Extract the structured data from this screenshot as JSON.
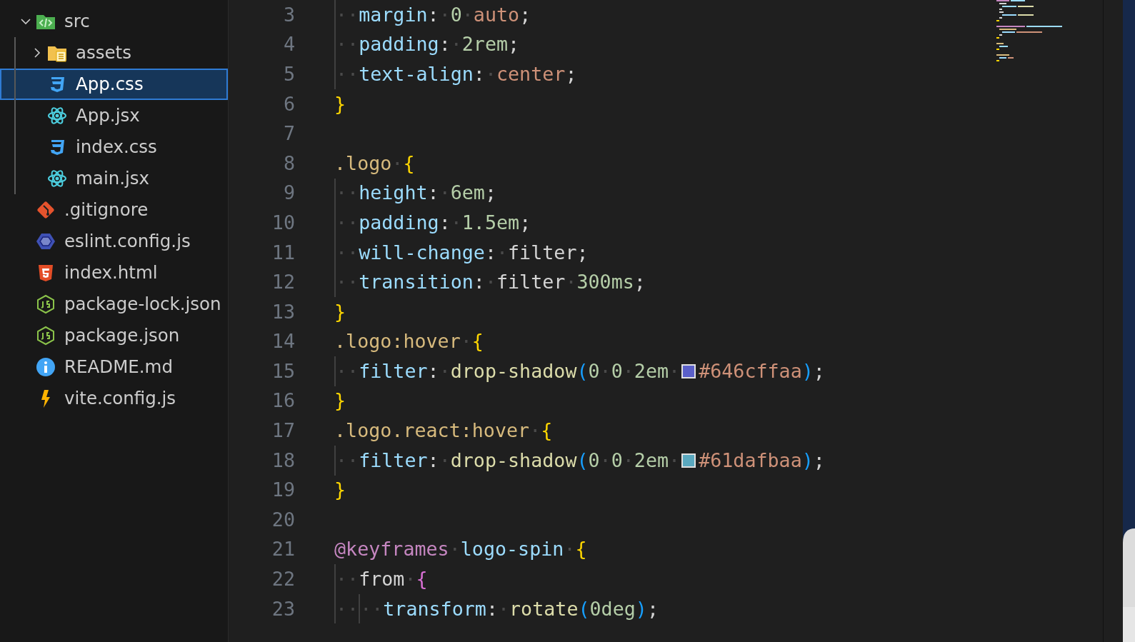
{
  "explorer": {
    "tree": [
      {
        "label": "src",
        "kind": "folder-code",
        "expanded": true,
        "selected": false,
        "children": [
          {
            "label": "assets",
            "kind": "folder-files",
            "expanded": false,
            "selected": false
          },
          {
            "label": "App.css",
            "kind": "css",
            "selected": true
          },
          {
            "label": "App.jsx",
            "kind": "react",
            "selected": false
          },
          {
            "label": "index.css",
            "kind": "css",
            "selected": false
          },
          {
            "label": "main.jsx",
            "kind": "react",
            "selected": false
          }
        ]
      },
      {
        "label": ".gitignore",
        "kind": "git",
        "selected": false
      },
      {
        "label": "eslint.config.js",
        "kind": "eslint",
        "selected": false
      },
      {
        "label": "index.html",
        "kind": "html",
        "selected": false
      },
      {
        "label": "package-lock.json",
        "kind": "node",
        "selected": false
      },
      {
        "label": "package.json",
        "kind": "node",
        "selected": false
      },
      {
        "label": "README.md",
        "kind": "info",
        "selected": false
      },
      {
        "label": "vite.config.js",
        "kind": "vite",
        "selected": false
      }
    ]
  },
  "editor": {
    "lines": [
      {
        "number": "3",
        "tokens": [
          {
            "kind": "guide",
            "t": "··"
          },
          {
            "kind": "prop",
            "t": "margin"
          },
          {
            "kind": "punct",
            "t": ":"
          },
          {
            "kind": "ws",
            "t": "·"
          },
          {
            "kind": "num",
            "t": "0"
          },
          {
            "kind": "ws",
            "t": "·"
          },
          {
            "kind": "str",
            "t": "auto"
          },
          {
            "kind": "punct",
            "t": ";"
          }
        ]
      },
      {
        "number": "4",
        "tokens": [
          {
            "kind": "guide",
            "t": "··"
          },
          {
            "kind": "prop",
            "t": "padding"
          },
          {
            "kind": "punct",
            "t": ":"
          },
          {
            "kind": "ws",
            "t": "·"
          },
          {
            "kind": "num",
            "t": "2rem"
          },
          {
            "kind": "punct",
            "t": ";"
          }
        ]
      },
      {
        "number": "5",
        "tokens": [
          {
            "kind": "guide",
            "t": "··"
          },
          {
            "kind": "prop",
            "t": "text-align"
          },
          {
            "kind": "punct",
            "t": ":"
          },
          {
            "kind": "ws",
            "t": "·"
          },
          {
            "kind": "str",
            "t": "center"
          },
          {
            "kind": "punct",
            "t": ";"
          }
        ]
      },
      {
        "number": "6",
        "tokens": [
          {
            "kind": "brace",
            "t": "}"
          }
        ]
      },
      {
        "number": "7"
      },
      {
        "number": "8",
        "tokens": [
          {
            "kind": "sel",
            "t": ".logo"
          },
          {
            "kind": "ws",
            "t": "·"
          },
          {
            "kind": "brace",
            "t": "{"
          }
        ]
      },
      {
        "number": "9",
        "tokens": [
          {
            "kind": "guide",
            "t": "··"
          },
          {
            "kind": "prop",
            "t": "height"
          },
          {
            "kind": "punct",
            "t": ":"
          },
          {
            "kind": "ws",
            "t": "·"
          },
          {
            "kind": "num",
            "t": "6em"
          },
          {
            "kind": "punct",
            "t": ";"
          }
        ]
      },
      {
        "number": "10",
        "tokens": [
          {
            "kind": "guide",
            "t": "··"
          },
          {
            "kind": "prop",
            "t": "padding"
          },
          {
            "kind": "punct",
            "t": ":"
          },
          {
            "kind": "ws",
            "t": "·"
          },
          {
            "kind": "num",
            "t": "1.5em"
          },
          {
            "kind": "punct",
            "t": ";"
          }
        ]
      },
      {
        "number": "11",
        "tokens": [
          {
            "kind": "guide",
            "t": "··"
          },
          {
            "kind": "prop",
            "t": "will-change"
          },
          {
            "kind": "punct",
            "t": ":"
          },
          {
            "kind": "ws",
            "t": "·"
          },
          {
            "kind": "plain",
            "t": "filter"
          },
          {
            "kind": "punct",
            "t": ";"
          }
        ]
      },
      {
        "number": "12",
        "tokens": [
          {
            "kind": "guide",
            "t": "··"
          },
          {
            "kind": "prop",
            "t": "transition"
          },
          {
            "kind": "punct",
            "t": ":"
          },
          {
            "kind": "ws",
            "t": "·"
          },
          {
            "kind": "plain",
            "t": "filter"
          },
          {
            "kind": "ws",
            "t": "·"
          },
          {
            "kind": "num",
            "t": "300ms"
          },
          {
            "kind": "punct",
            "t": ";"
          }
        ]
      },
      {
        "number": "13",
        "tokens": [
          {
            "kind": "brace",
            "t": "}"
          }
        ]
      },
      {
        "number": "14",
        "tokens": [
          {
            "kind": "sel",
            "t": ".logo:hover"
          },
          {
            "kind": "ws",
            "t": "·"
          },
          {
            "kind": "brace",
            "t": "{"
          }
        ]
      },
      {
        "number": "15",
        "tokens": [
          {
            "kind": "guide",
            "t": "··"
          },
          {
            "kind": "prop",
            "t": "filter"
          },
          {
            "kind": "punct",
            "t": ":"
          },
          {
            "kind": "ws",
            "t": "·"
          },
          {
            "kind": "func",
            "t": "drop-shadow"
          },
          {
            "kind": "paren",
            "t": "("
          },
          {
            "kind": "num",
            "t": "0"
          },
          {
            "kind": "ws",
            "t": "·"
          },
          {
            "kind": "num",
            "t": "0"
          },
          {
            "kind": "ws",
            "t": "·"
          },
          {
            "kind": "num",
            "t": "2em"
          },
          {
            "kind": "ws",
            "t": "·"
          },
          {
            "kind": "swatch",
            "color": "#5a5fc8"
          },
          {
            "kind": "str",
            "t": "#646cffaa"
          },
          {
            "kind": "paren",
            "t": ")"
          },
          {
            "kind": "punct",
            "t": ";"
          }
        ]
      },
      {
        "number": "16",
        "tokens": [
          {
            "kind": "brace",
            "t": "}"
          }
        ]
      },
      {
        "number": "17",
        "tokens": [
          {
            "kind": "sel",
            "t": ".logo.react:hover"
          },
          {
            "kind": "ws",
            "t": "·"
          },
          {
            "kind": "brace",
            "t": "{"
          }
        ]
      },
      {
        "number": "18",
        "tokens": [
          {
            "kind": "guide",
            "t": "··"
          },
          {
            "kind": "prop",
            "t": "filter"
          },
          {
            "kind": "punct",
            "t": ":"
          },
          {
            "kind": "ws",
            "t": "·"
          },
          {
            "kind": "func",
            "t": "drop-shadow"
          },
          {
            "kind": "paren",
            "t": "("
          },
          {
            "kind": "num",
            "t": "0"
          },
          {
            "kind": "ws",
            "t": "·"
          },
          {
            "kind": "num",
            "t": "0"
          },
          {
            "kind": "ws",
            "t": "·"
          },
          {
            "kind": "num",
            "t": "2em"
          },
          {
            "kind": "ws",
            "t": "·"
          },
          {
            "kind": "swatch",
            "color": "#5aa8bf"
          },
          {
            "kind": "str",
            "t": "#61dafbaa"
          },
          {
            "kind": "paren",
            "t": ")"
          },
          {
            "kind": "punct",
            "t": ";"
          }
        ]
      },
      {
        "number": "19",
        "tokens": [
          {
            "kind": "brace",
            "t": "}"
          }
        ]
      },
      {
        "number": "20"
      },
      {
        "number": "21",
        "tokens": [
          {
            "kind": "at",
            "t": "@keyframes"
          },
          {
            "kind": "ws",
            "t": "·"
          },
          {
            "kind": "prop",
            "t": "logo-spin"
          },
          {
            "kind": "ws",
            "t": "·"
          },
          {
            "kind": "brace",
            "t": "{"
          }
        ]
      },
      {
        "number": "22",
        "tokens": [
          {
            "kind": "guide",
            "t": "··"
          },
          {
            "kind": "plain",
            "t": "from"
          },
          {
            "kind": "ws",
            "t": "·"
          },
          {
            "kind": "brace2",
            "t": "{"
          }
        ]
      },
      {
        "number": "23",
        "tokens": [
          {
            "kind": "guide",
            "t": "··"
          },
          {
            "kind": "guide",
            "t": "··"
          },
          {
            "kind": "prop",
            "t": "transform"
          },
          {
            "kind": "punct",
            "t": ":"
          },
          {
            "kind": "ws",
            "t": "·"
          },
          {
            "kind": "func",
            "t": "rotate"
          },
          {
            "kind": "paren",
            "t": "("
          },
          {
            "kind": "num",
            "t": "0deg"
          },
          {
            "kind": "paren",
            "t": ")"
          },
          {
            "kind": "punct",
            "t": ";"
          }
        ]
      }
    ]
  }
}
